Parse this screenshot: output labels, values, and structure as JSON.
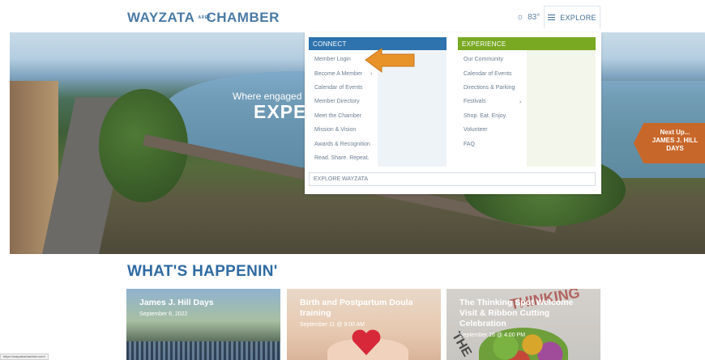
{
  "header": {
    "logo_left": "WAYZATA",
    "logo_small": "AREA",
    "logo_right": "CHAMBER",
    "weather_icon": "sun-icon",
    "temperature": "83°",
    "explore_label": "EXPLORE"
  },
  "hero": {
    "tagline": "Where engaged",
    "headline": "EXPE",
    "next_up_line1": "Next Up...",
    "next_up_line2": "JAMES J. HILL",
    "next_up_line3": "DAYS"
  },
  "dropdown": {
    "connect_header": "CONNECT",
    "experience_header": "EXPERIENCE",
    "connect_items": [
      "Member Login",
      "Become A Member",
      "Calendar of Events",
      "Member Directory",
      "Meet the Chamber",
      "Mission & Vision",
      "Awards & Recognition",
      "Read. Share. Repeat."
    ],
    "experience_items": [
      "Our Community",
      "Calendar of Events",
      "Directions & Parking",
      "Festivals",
      "Shop. Eat. Enjoy.",
      "Volunteer",
      "FAQ"
    ],
    "explore_wayzata": "EXPLORE WAYZATA",
    "accent_connect": "#2e73ad",
    "accent_experience": "#79a923",
    "arrow_color": "#e8922a"
  },
  "happening": {
    "title_bold": "WHAT'S",
    "title_rest": "HAPPENIN'",
    "cards": [
      {
        "title": "James J. Hill Days",
        "date": "September 8, 2022"
      },
      {
        "title": "Birth and Postpartum Doula training",
        "date": "September 11 @ 9:00 AM"
      },
      {
        "title": "The Thinking Spot Welcome Visit & Ribbon Cutting Celebration",
        "date": "September 16 @ 4:00 PM"
      }
    ],
    "card3_art_top": "THINKING",
    "card3_art_side": "THE"
  },
  "status_bar": {
    "url": "https://wayzatachamber.com/"
  }
}
